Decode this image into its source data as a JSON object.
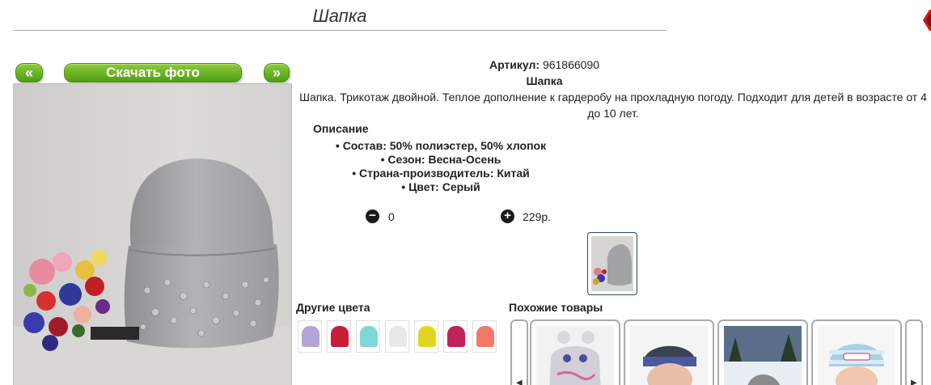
{
  "page": {
    "title": "Шапка"
  },
  "gallery": {
    "prev_label": "«",
    "download_label": "Скачать фото",
    "next_label": "»"
  },
  "product": {
    "sku_label": "Артикул:",
    "sku_value": "961866090",
    "name": "Шапка",
    "description": "Шапка. Трикотаж двойной. Теплое дополнение к гардеробу на прохладную погоду. Подходит для детей в возрасте от 4 до 10 лет.",
    "description_title": "Описание",
    "properties": [
      "Состав: 50% полиэстер, 50% хлопок",
      "Сезон: Весна-Осень",
      "Страна-производитель: Китай",
      "Цвет: Серый"
    ]
  },
  "cart": {
    "minus_icon": "minus-circle-icon",
    "plus_icon": "plus-circle-icon",
    "quantity": "0",
    "price": "229р."
  },
  "other_colors": {
    "title": "Другие цвета",
    "swatches": [
      "#b6a4d6",
      "#c91e3a",
      "#7fd6d6",
      "#e8e8e8",
      "#e0d820",
      "#c0225a",
      "#f07a68"
    ]
  },
  "similar": {
    "title": "Похожие товары"
  },
  "colors": {
    "button_green": "#5aa81c",
    "accent_red": "#d11a1a"
  }
}
